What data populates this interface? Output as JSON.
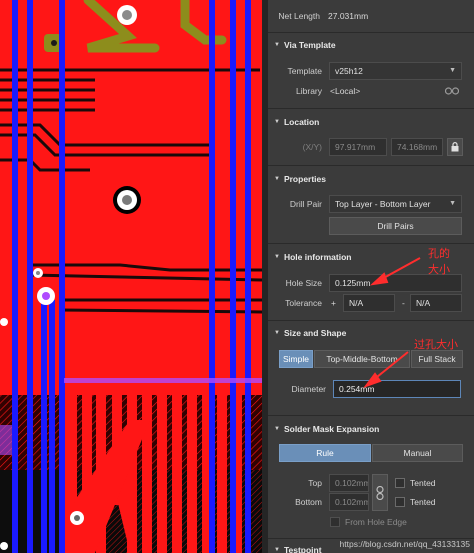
{
  "top": {
    "net_length_label": "Net Length",
    "net_length_value": "27.031mm"
  },
  "via_template": {
    "title": "Via Template",
    "template_label": "Template",
    "template_value": "v25h12",
    "library_label": "Library",
    "library_value": "<Local>"
  },
  "location": {
    "title": "Location",
    "xy_label": "(X/Y)",
    "x_value": "97.917mm",
    "y_value": "74.168mm"
  },
  "properties": {
    "title": "Properties",
    "drill_pair_label": "Drill Pair",
    "drill_pair_value": "Top Layer - Bottom Layer",
    "drill_pairs_button": "Drill Pairs"
  },
  "hole_information": {
    "title": "Hole information",
    "hole_size_label": "Hole Size",
    "hole_size_value": "0.125mm",
    "tolerance_label": "Tolerance",
    "plus_sign": "+",
    "minus_sign": "-",
    "tol_plus_value": "N/A",
    "tol_minus_value": "N/A"
  },
  "size_shape": {
    "title": "Size and Shape",
    "tabs": [
      "Simple",
      "Top-Middle-Bottom",
      "Full Stack"
    ],
    "diameter_label": "Diameter",
    "diameter_value": "0.254mm"
  },
  "solder_mask": {
    "title": "Solder Mask Expansion",
    "rule_button": "Rule",
    "manual_button": "Manual",
    "top_label": "Top",
    "top_value": "0.102mm",
    "bottom_label": "Bottom",
    "bottom_value": "0.102mm",
    "tented_top": "Tented",
    "tented_bottom": "Tented",
    "from_hole_edge": "From Hole Edge"
  },
  "testpoint": {
    "title": "Testpoint"
  },
  "annotations": {
    "hole_size_note_1": "孔的",
    "hole_size_note_2": "大小",
    "via_size_note": "过孔大小"
  },
  "watermark": "https://blog.csdn.net/qq_43133135",
  "icons": {
    "collapse": "triangle-down-icon",
    "lock": "lock-icon",
    "link": "link-icon",
    "chain": "chain-icon"
  },
  "colors": {
    "copper_red": "#ff1616",
    "via_blue": "#1a1aff",
    "silk_olive": "#8d8d1c",
    "panel_bg": "#3b3b3b",
    "accent_blue": "#6a8fb8",
    "annotation_red": "#ff2d2d"
  }
}
